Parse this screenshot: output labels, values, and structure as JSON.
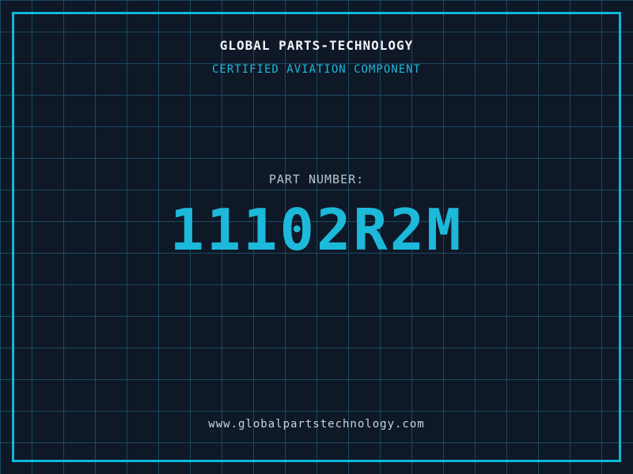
{
  "colors": {
    "background": "#0f1827",
    "grid": "#1a4a60",
    "frame": "#0db8d9",
    "accent_cyan": "#1db9da",
    "title_white": "#f2f5f7",
    "label_gray": "#b9c3cb",
    "url_gray": "#ccd5d9"
  },
  "header": {
    "company": "GLOBAL PARTS-TECHNOLOGY",
    "tagline": "CERTIFIED AVIATION COMPONENT"
  },
  "part": {
    "label": "PART NUMBER:",
    "number": "11102R2M"
  },
  "footer": {
    "website": "www.globalpartstechnology.com"
  }
}
